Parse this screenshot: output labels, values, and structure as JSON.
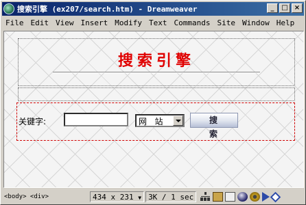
{
  "window": {
    "title": "搜索引擎 (ex207/search.htm) - Dreamweaver",
    "buttons": {
      "minimize": "_",
      "maximize": "□",
      "close": "×"
    }
  },
  "menu": [
    "File",
    "Edit",
    "View",
    "Insert",
    "Modify",
    "Text",
    "Commands",
    "Site",
    "Window",
    "Help"
  ],
  "page": {
    "title": "搜索引擎",
    "form": {
      "keyword_label": "关键字:",
      "keyword_value": "",
      "select_value": "网   站",
      "search_button": "搜 索"
    }
  },
  "status": {
    "tags": "<body> <div>",
    "dimensions": "434 x 231",
    "download": "3K / 1 sec"
  },
  "icons": [
    "sitemap-icon",
    "library-icon",
    "html-source-icon",
    "browser-icon",
    "behaviors-icon",
    "preview-icon",
    "assets-icon"
  ]
}
